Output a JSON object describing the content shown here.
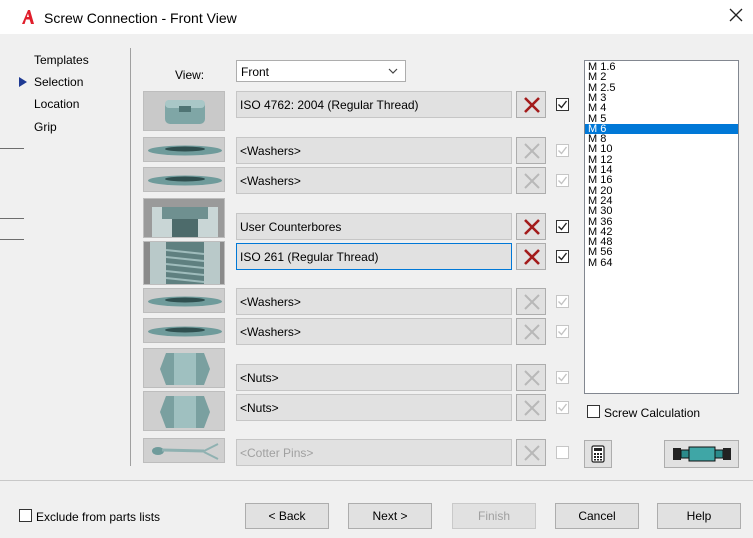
{
  "window": {
    "title": "Screw Connection - Front View",
    "close_icon": "close-icon",
    "accent": "#0078d7"
  },
  "nav": {
    "items": [
      {
        "label": "Templates",
        "active": false
      },
      {
        "label": "Selection",
        "active": true
      },
      {
        "label": "Location",
        "active": false
      },
      {
        "label": "Grip",
        "active": false
      }
    ]
  },
  "view": {
    "label": "View:",
    "value": "Front"
  },
  "rows": [
    {
      "image": "socket-head-screw",
      "label": "ISO 4762: 2004 (Regular Thread)",
      "checked": true,
      "enabled": true
    },
    {
      "image": "washer",
      "label": "<Washers>",
      "checked": true,
      "enabled": false
    },
    {
      "image": "washer",
      "label": "<Washers>",
      "checked": true,
      "enabled": false
    },
    {
      "image": "counterbore",
      "label": "User Counterbores",
      "checked": true,
      "enabled": true
    },
    {
      "image": "threaded-hole",
      "label": "ISO 261  (Regular Thread)",
      "checked": true,
      "enabled": true
    },
    {
      "image": "washer",
      "label": "<Washers>",
      "checked": true,
      "enabled": false
    },
    {
      "image": "washer",
      "label": "<Washers>",
      "checked": true,
      "enabled": false
    },
    {
      "image": "nut",
      "label": "<Nuts>",
      "checked": true,
      "enabled": false
    },
    {
      "image": "nut",
      "label": "<Nuts>",
      "checked": true,
      "enabled": false
    },
    {
      "image": "cotter-pin",
      "label": "<Cotter Pins>",
      "checked": false,
      "enabled": false
    }
  ],
  "sizes": {
    "items": [
      "M 1.6",
      "M 2",
      "M 2.5",
      "M 3",
      "M 4",
      "M 5",
      "M 6",
      "M 8",
      "M 10",
      "M 12",
      "M 14",
      "M 16",
      "M 20",
      "M 24",
      "M 30",
      "M 36",
      "M 42",
      "M 48",
      "M 56",
      "M 64"
    ],
    "selected": "M 6"
  },
  "screw_calculation": {
    "label": "Screw Calculation",
    "checked": false
  },
  "exclude": {
    "label": "Exclude from parts lists",
    "checked": false
  },
  "buttons": {
    "back": "< Back",
    "next": "Next >",
    "finish": "Finish",
    "cancel": "Cancel",
    "help": "Help"
  }
}
